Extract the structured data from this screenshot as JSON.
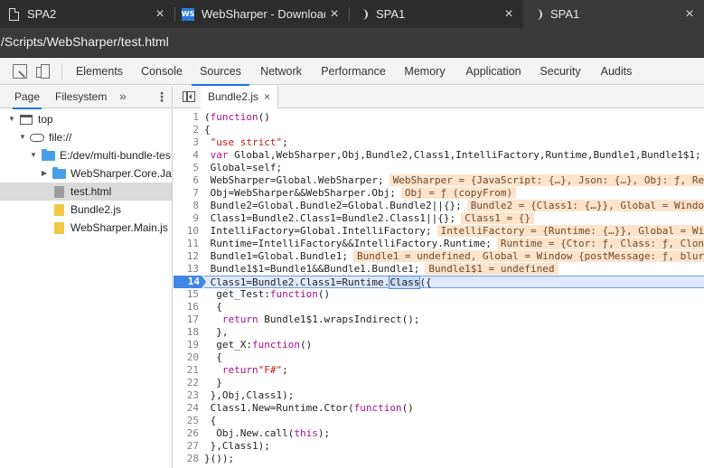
{
  "browser_tabs": [
    {
      "title": "SPA2",
      "icon": "document-icon"
    },
    {
      "title": "WebSharper - Downloads",
      "icon": "websharper-icon"
    },
    {
      "title": "SPA1",
      "icon": "loading-icon"
    },
    {
      "title": "SPA1",
      "icon": "loading-icon"
    }
  ],
  "tab_close_glyph": "×",
  "address": "/Scripts/WebSharper/test.html",
  "websharper_icon_text": "WS",
  "devtools_tabs": [
    "Elements",
    "Console",
    "Sources",
    "Network",
    "Performance",
    "Memory",
    "Application",
    "Security",
    "Audits"
  ],
  "navigator": {
    "tabs": [
      "Page",
      "Filesystem"
    ],
    "more": "»",
    "menu": "⋮",
    "tree": [
      {
        "label": "top",
        "arrow": "▼"
      },
      {
        "label": "file://",
        "arrow": "▼"
      },
      {
        "label": "E:/dev/multi-bundle-tes",
        "arrow": "▼"
      },
      {
        "label": "WebSharper.Core.Java",
        "arrow": "▶"
      },
      {
        "label": "test.html"
      },
      {
        "label": "Bundle2.js"
      },
      {
        "label": "WebSharper.Main.js"
      }
    ]
  },
  "editor": {
    "tab": "Bundle2.js",
    "close": "×",
    "highlight_line": 14,
    "lines": [
      {
        "n": "1",
        "code": "(function()"
      },
      {
        "n": "2",
        "code": "{"
      },
      {
        "n": "3",
        "code": " \"use strict\";"
      },
      {
        "n": "4",
        "code": " var Global,WebSharper,Obj,Bundle2,Class1,IntelliFactory,Runtime,Bundle1,Bundle1$1;"
      },
      {
        "n": "5",
        "code": " Global=self;"
      },
      {
        "n": "6",
        "code": " WebSharper=Global.WebSharper;",
        "eval": "WebSharper = {JavaScript: {…}, Json: {…}, Obj: ƒ, Re"
      },
      {
        "n": "7",
        "code": " Obj=WebSharper&&WebSharper.Obj;",
        "eval": "Obj = ƒ (copyFrom)"
      },
      {
        "n": "8",
        "code": " Bundle2=Global.Bundle2=Global.Bundle2||{};",
        "eval": "Bundle2 = {Class1: {…}}, Global = Windo"
      },
      {
        "n": "9",
        "code": " Class1=Bundle2.Class1=Bundle2.Class1||{};",
        "eval": "Class1 = {}"
      },
      {
        "n": "10",
        "code": " IntelliFactory=Global.IntelliFactory;",
        "eval": "IntelliFactory = {Runtime: {…}}, Global = Wi"
      },
      {
        "n": "11",
        "code": " Runtime=IntelliFactory&&IntelliFactory.Runtime;",
        "eval": "Runtime = {Ctor: ƒ, Class: ƒ, Clon"
      },
      {
        "n": "12",
        "code": " Bundle1=Global.Bundle1;",
        "eval": "Bundle1 = undefined, Global = Window {postMessage: ƒ, blur"
      },
      {
        "n": "13",
        "code": " Bundle1$1=Bundle1&&Bundle1.Bundle1;",
        "eval": "Bundle1$1 = undefined"
      },
      {
        "n": "14",
        "code_before": " Class1=Bundle2.Class1=Runtime.",
        "code_hl": "Class",
        "code_after": "({"
      },
      {
        "n": "15",
        "code": "  get_Test:function()"
      },
      {
        "n": "16",
        "code": "  {"
      },
      {
        "n": "17",
        "code": "   return Bundle1$1.wrapsIndirect();"
      },
      {
        "n": "18",
        "code": "  },"
      },
      {
        "n": "19",
        "code": "  get_X:function()"
      },
      {
        "n": "20",
        "code": "  {"
      },
      {
        "n": "21",
        "code": "   return\"F#\";"
      },
      {
        "n": "22",
        "code": "  }"
      },
      {
        "n": "23",
        "code": " },Obj,Class1);"
      },
      {
        "n": "24",
        "code": " Class1.New=Runtime.Ctor(function()"
      },
      {
        "n": "25",
        "code": " {"
      },
      {
        "n": "26",
        "code": "  Obj.New.call(this);"
      },
      {
        "n": "27",
        "code": " },Class1);"
      },
      {
        "n": "28",
        "code": "}());"
      }
    ]
  },
  "colors": {
    "accent": "#1a73e8",
    "breakpoint": "#4186e4",
    "eval_bg": "#fde3cc"
  }
}
